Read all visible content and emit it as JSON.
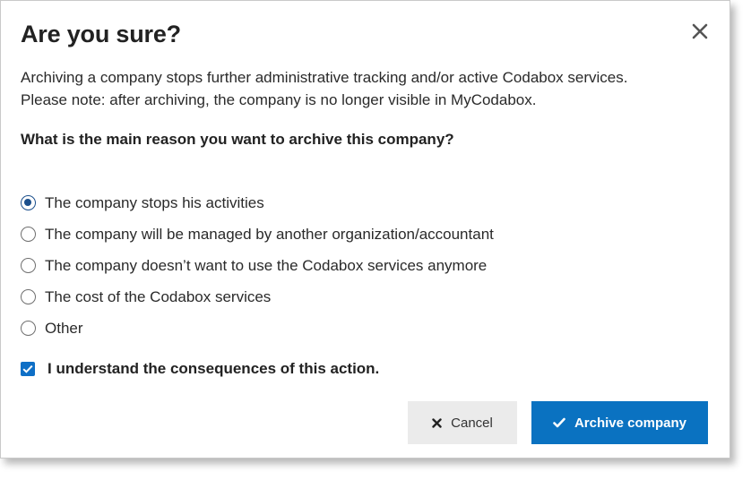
{
  "dialog": {
    "title": "Are you sure?",
    "description_line1": "Archiving a company stops further administrative tracking and/or active Codabox services.",
    "description_line2": "Please note: after archiving, the company is no longer visible in MyCodabox.",
    "question": "What is the main reason you want to archive this company?",
    "options": [
      {
        "label": "The company stops his activities",
        "selected": true
      },
      {
        "label": "The company will be managed by another organization/accountant",
        "selected": false
      },
      {
        "label": "The company doesn’t want to use the Codabox services anymore",
        "selected": false
      },
      {
        "label": "The cost of the Codabox services",
        "selected": false
      },
      {
        "label": "Other",
        "selected": false
      }
    ],
    "confirm_label": "I understand the consequences of this action.",
    "confirm_checked": true,
    "cancel_label": "Cancel",
    "archive_label": "Archive company"
  },
  "icons": {
    "close": "close-icon",
    "cancel": "x-icon",
    "archive": "check-icon"
  },
  "colors": {
    "primary": "#0a72c1",
    "radio_selected": "#1b4f8c",
    "cancel_bg": "#ebebeb"
  }
}
